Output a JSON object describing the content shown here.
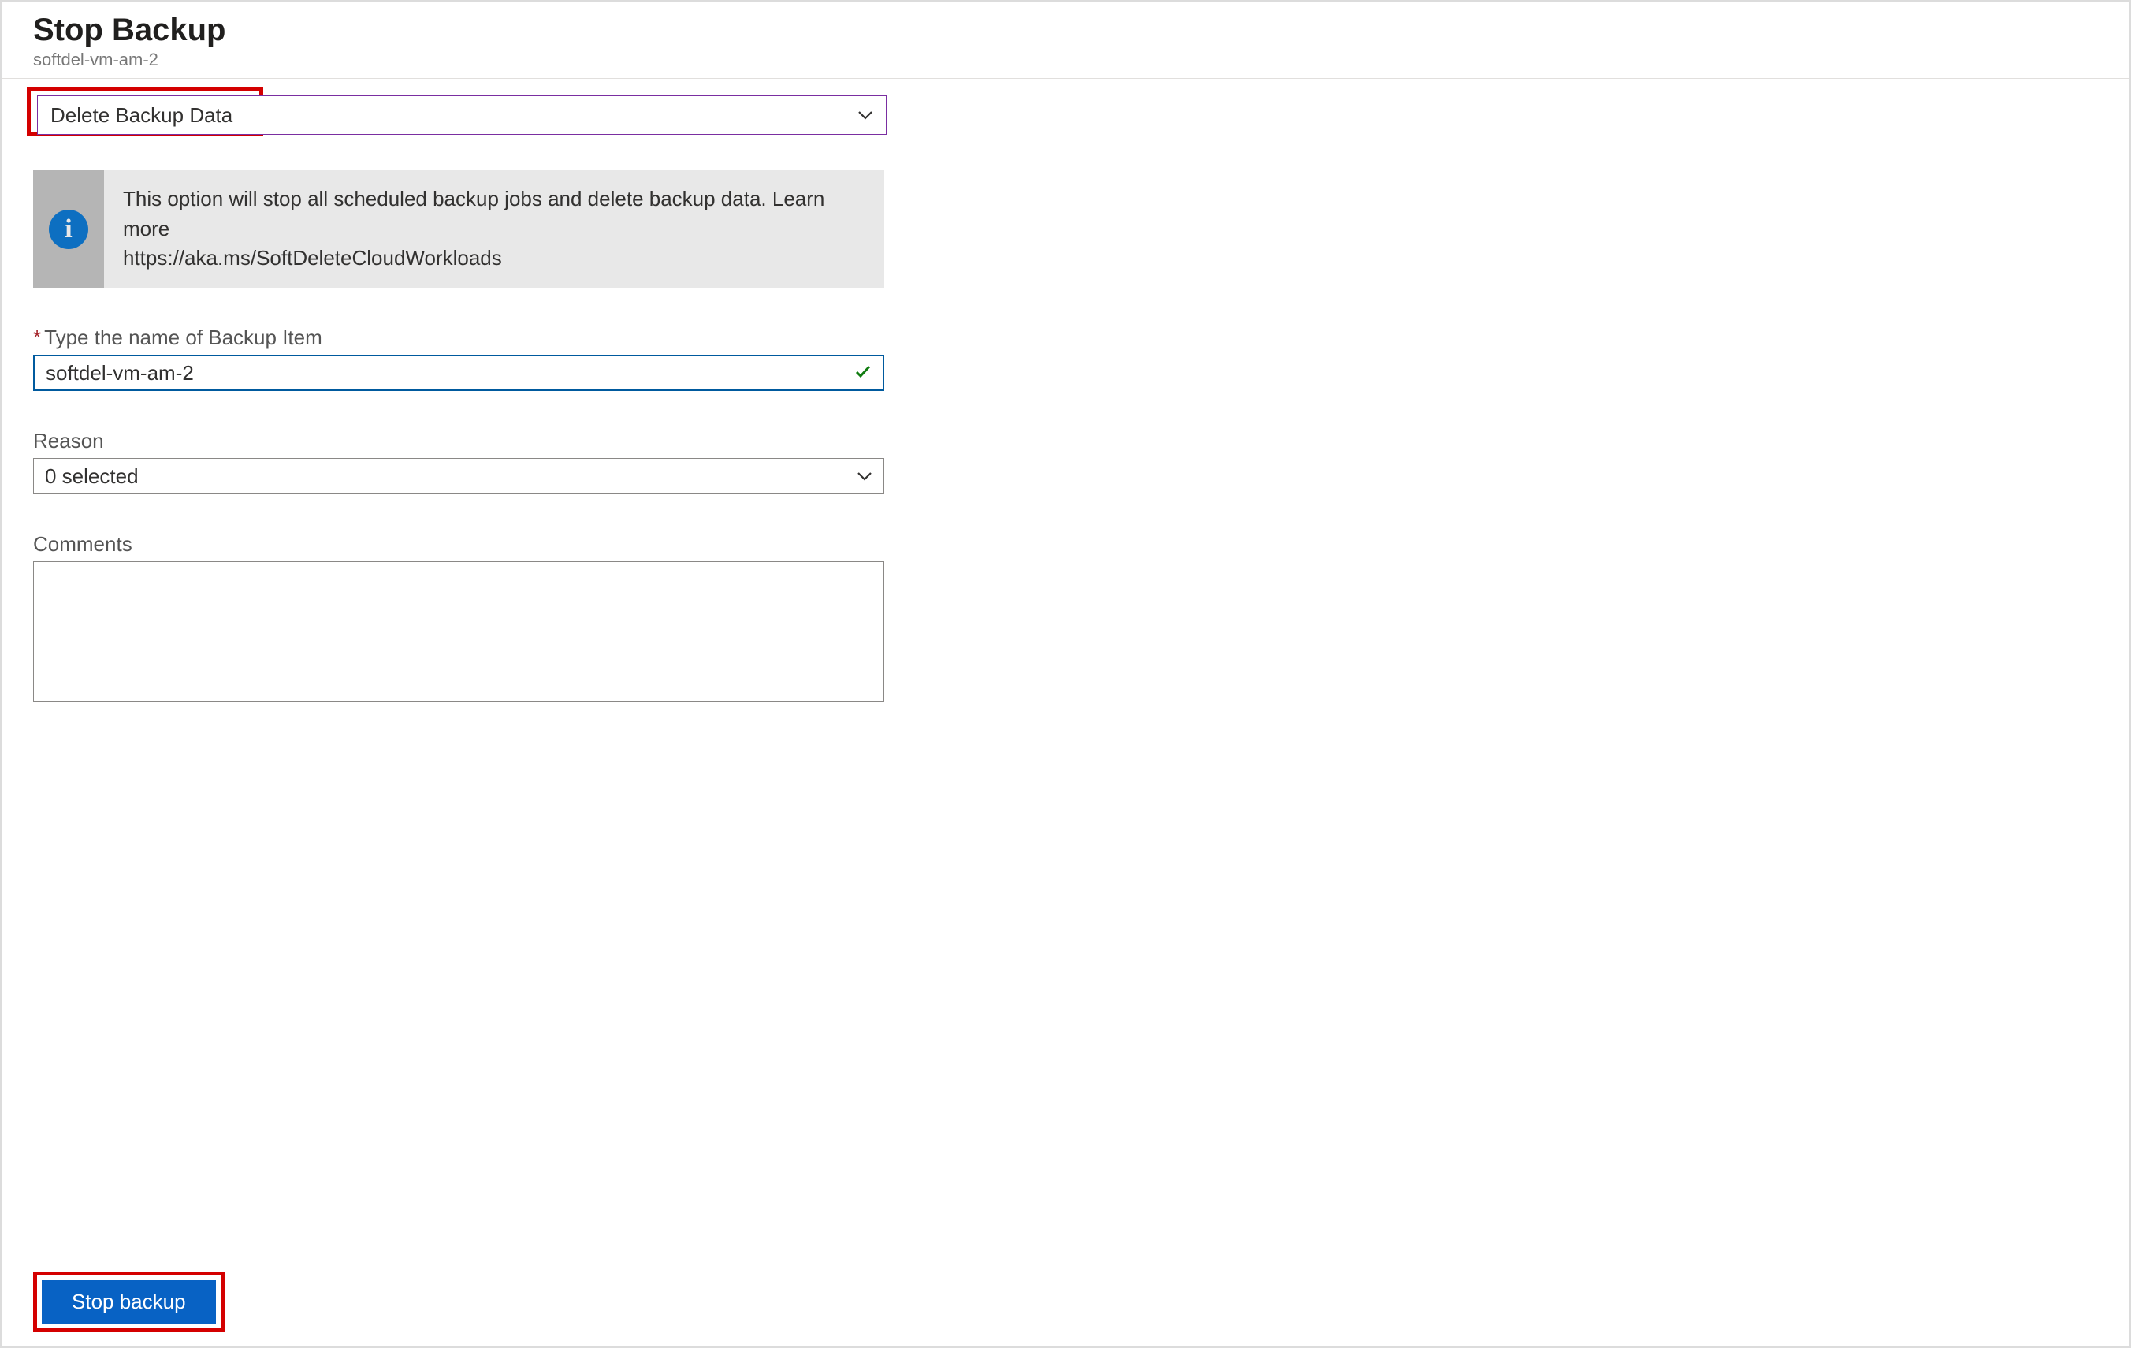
{
  "header": {
    "title": "Stop Backup",
    "subtitle": "softdel-vm-am-2"
  },
  "actionDropdown": {
    "selected": "Delete Backup Data"
  },
  "infoBox": {
    "line1": "This option will stop all scheduled backup jobs and delete backup data. Learn more",
    "line2": "https://aka.ms/SoftDeleteCloudWorkloads"
  },
  "fields": {
    "nameLabel": "Type the name of Backup Item",
    "nameValue": "softdel-vm-am-2",
    "reasonLabel": "Reason",
    "reasonValue": "0 selected",
    "commentsLabel": "Comments",
    "commentsValue": ""
  },
  "footer": {
    "submitLabel": "Stop backup"
  }
}
